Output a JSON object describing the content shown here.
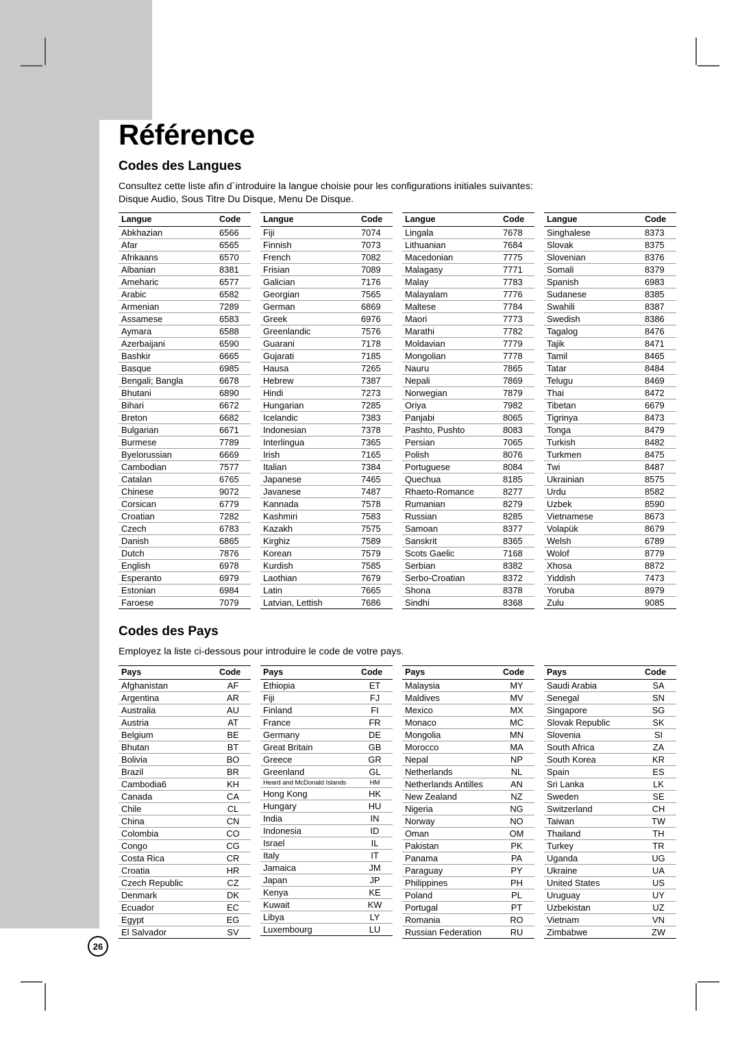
{
  "page": {
    "number": "26",
    "title": "Référence"
  },
  "languages_section": {
    "heading": "Codes des Langues",
    "intro": "Consultez cette liste afin d´introduire la langue choisie pour les configurations initiales suivantes: Disque Audio, Sous Titre Du Disque, Menu De Disque.",
    "intro_line1": "Consultez cette liste afin d´introduire la langue choisie pour les configurations initiales suivantes:",
    "intro_line2": "Disque Audio, Sous Titre Du Disque, Menu De Disque.",
    "headers": [
      "Langue",
      "Code"
    ],
    "columns": [
      [
        [
          "Abkhazian",
          "6566"
        ],
        [
          "Afar",
          "6565"
        ],
        [
          "Afrikaans",
          "6570"
        ],
        [
          "Albanian",
          "8381"
        ],
        [
          "Ameharic",
          "6577"
        ],
        [
          "Arabic",
          "6582"
        ],
        [
          "Armenian",
          "7289"
        ],
        [
          "Assamese",
          "6583"
        ],
        [
          "Aymara",
          "6588"
        ],
        [
          "Azerbaijani",
          "6590"
        ],
        [
          "Bashkir",
          "6665"
        ],
        [
          "Basque",
          "6985"
        ],
        [
          "Bengali; Bangla",
          "6678"
        ],
        [
          "Bhutani",
          "6890"
        ],
        [
          "Bihari",
          "6672"
        ],
        [
          "Breton",
          "6682"
        ],
        [
          "Bulgarian",
          "6671"
        ],
        [
          "Burmese",
          "7789"
        ],
        [
          "Byelorussian",
          "6669"
        ],
        [
          "Cambodian",
          "7577"
        ],
        [
          "Catalan",
          "6765"
        ],
        [
          "Chinese",
          "9072"
        ],
        [
          "Corsican",
          "6779"
        ],
        [
          "Croatian",
          "7282"
        ],
        [
          "Czech",
          "6783"
        ],
        [
          "Danish",
          "6865"
        ],
        [
          "Dutch",
          "7876"
        ],
        [
          "English",
          "6978"
        ],
        [
          "Esperanto",
          "6979"
        ],
        [
          "Estonian",
          "6984"
        ],
        [
          "Faroese",
          "7079"
        ]
      ],
      [
        [
          "Fiji",
          "7074"
        ],
        [
          "Finnish",
          "7073"
        ],
        [
          "French",
          "7082"
        ],
        [
          "Frisian",
          "7089"
        ],
        [
          "Galician",
          "7176"
        ],
        [
          "Georgian",
          "7565"
        ],
        [
          "German",
          "6869"
        ],
        [
          "Greek",
          "6976"
        ],
        [
          "Greenlandic",
          "7576"
        ],
        [
          "Guarani",
          "7178"
        ],
        [
          "Gujarati",
          "7185"
        ],
        [
          "Hausa",
          "7265"
        ],
        [
          "Hebrew",
          "7387"
        ],
        [
          "Hindi",
          "7273"
        ],
        [
          "Hungarian",
          "7285"
        ],
        [
          "Icelandic",
          "7383"
        ],
        [
          "Indonesian",
          "7378"
        ],
        [
          "Interlingua",
          "7365"
        ],
        [
          "Irish",
          "7165"
        ],
        [
          "Italian",
          "7384"
        ],
        [
          "Japanese",
          "7465"
        ],
        [
          "Javanese",
          "7487"
        ],
        [
          "Kannada",
          "7578"
        ],
        [
          "Kashmiri",
          "7583"
        ],
        [
          "Kazakh",
          "7575"
        ],
        [
          "Kirghiz",
          "7589"
        ],
        [
          "Korean",
          "7579"
        ],
        [
          "Kurdish",
          "7585"
        ],
        [
          "Laothian",
          "7679"
        ],
        [
          "Latin",
          "7665"
        ],
        [
          "Latvian, Lettish",
          "7686"
        ]
      ],
      [
        [
          "Lingala",
          "7678"
        ],
        [
          "Lithuanian",
          "7684"
        ],
        [
          "Macedonian",
          "7775"
        ],
        [
          "Malagasy",
          "7771"
        ],
        [
          "Malay",
          "7783"
        ],
        [
          "Malayalam",
          "7776"
        ],
        [
          "Maltese",
          "7784"
        ],
        [
          "Maori",
          "7773"
        ],
        [
          "Marathi",
          "7782"
        ],
        [
          "Moldavian",
          "7779"
        ],
        [
          "Mongolian",
          "7778"
        ],
        [
          "Nauru",
          "7865"
        ],
        [
          "Nepali",
          "7869"
        ],
        [
          "Norwegian",
          "7879"
        ],
        [
          "Oriya",
          "7982"
        ],
        [
          "Panjabi",
          "8065"
        ],
        [
          "Pashto, Pushto",
          "8083"
        ],
        [
          "Persian",
          "7065"
        ],
        [
          "Polish",
          "8076"
        ],
        [
          "Portuguese",
          "8084"
        ],
        [
          "Quechua",
          "8185"
        ],
        [
          "Rhaeto-Romance",
          "8277"
        ],
        [
          "Rumanian",
          "8279"
        ],
        [
          "Russian",
          "8285"
        ],
        [
          "Samoan",
          "8377"
        ],
        [
          "Sanskrit",
          "8365"
        ],
        [
          "Scots Gaelic",
          "7168"
        ],
        [
          "Serbian",
          "8382"
        ],
        [
          "Serbo-Croatian",
          "8372"
        ],
        [
          "Shona",
          "8378"
        ],
        [
          "Sindhi",
          "8368"
        ]
      ],
      [
        [
          "Singhalese",
          "8373"
        ],
        [
          "Slovak",
          "8375"
        ],
        [
          "Slovenian",
          "8376"
        ],
        [
          "Somali",
          "8379"
        ],
        [
          "Spanish",
          "6983"
        ],
        [
          "Sudanese",
          "8385"
        ],
        [
          "Swahili",
          "8387"
        ],
        [
          "Swedish",
          "8386"
        ],
        [
          "Tagalog",
          "8476"
        ],
        [
          "Tajik",
          "8471"
        ],
        [
          "Tamil",
          "8465"
        ],
        [
          "Tatar",
          "8484"
        ],
        [
          "Telugu",
          "8469"
        ],
        [
          "Thai",
          "8472"
        ],
        [
          "Tibetan",
          "6679"
        ],
        [
          "Tigrinya",
          "8473"
        ],
        [
          "Tonga",
          "8479"
        ],
        [
          "Turkish",
          "8482"
        ],
        [
          "Turkmen",
          "8475"
        ],
        [
          "Twi",
          "8487"
        ],
        [
          "Ukrainian",
          "8575"
        ],
        [
          "Urdu",
          "8582"
        ],
        [
          "Uzbek",
          "8590"
        ],
        [
          "Vietnamese",
          "8673"
        ],
        [
          "Volapük",
          "8679"
        ],
        [
          "Welsh",
          "6789"
        ],
        [
          "Wolof",
          "8779"
        ],
        [
          "Xhosa",
          "8872"
        ],
        [
          "Yiddish",
          "7473"
        ],
        [
          "Yoruba",
          "8979"
        ],
        [
          "Zulu",
          "9085"
        ]
      ]
    ]
  },
  "countries_section": {
    "heading": "Codes des Pays",
    "intro": "Employez la liste ci-dessous pour introduire le code de votre pays.",
    "headers": [
      "Pays",
      "Code"
    ],
    "columns": [
      [
        [
          "Afghanistan",
          "AF"
        ],
        [
          "Argentina",
          "AR"
        ],
        [
          "Australia",
          "AU"
        ],
        [
          "Austria",
          "AT"
        ],
        [
          "Belgium",
          "BE"
        ],
        [
          "Bhutan",
          "BT"
        ],
        [
          "Bolivia",
          "BO"
        ],
        [
          "Brazil",
          "BR"
        ],
        [
          "Cambodia6",
          "KH"
        ],
        [
          "Canada",
          "CA"
        ],
        [
          "Chile",
          "CL"
        ],
        [
          "China",
          "CN"
        ],
        [
          "Colombia",
          "CO"
        ],
        [
          "Congo",
          "CG"
        ],
        [
          "Costa Rica",
          "CR"
        ],
        [
          "Croatia",
          "HR"
        ],
        [
          "Czech Republic",
          "CZ"
        ],
        [
          "Denmark",
          "DK"
        ],
        [
          "Ecuador",
          "EC"
        ],
        [
          "Egypt",
          "EG"
        ],
        [
          "El Salvador",
          "SV"
        ]
      ],
      [
        [
          "Ethiopia",
          "ET"
        ],
        [
          "Fiji",
          "FJ"
        ],
        [
          "Finland",
          "FI"
        ],
        [
          "France",
          "FR"
        ],
        [
          "Germany",
          "DE"
        ],
        [
          "Great Britain",
          "GB"
        ],
        [
          "Greece",
          "GR"
        ],
        [
          "Greenland",
          "GL"
        ],
        [
          "Heard and McDonald Islands",
          "HM"
        ],
        [
          "Hong Kong",
          "HK"
        ],
        [
          "Hungary",
          "HU"
        ],
        [
          "India",
          "IN"
        ],
        [
          "Indonesia",
          "ID"
        ],
        [
          "Israel",
          "IL"
        ],
        [
          "Italy",
          "IT"
        ],
        [
          "Jamaica",
          "JM"
        ],
        [
          "Japan",
          "JP"
        ],
        [
          "Kenya",
          "KE"
        ],
        [
          "Kuwait",
          "KW"
        ],
        [
          "Libya",
          "LY"
        ],
        [
          "Luxembourg",
          "LU"
        ]
      ],
      [
        [
          "Malaysia",
          "MY"
        ],
        [
          "Maldives",
          "MV"
        ],
        [
          "Mexico",
          "MX"
        ],
        [
          "Monaco",
          "MC"
        ],
        [
          "Mongolia",
          "MN"
        ],
        [
          "Morocco",
          "MA"
        ],
        [
          "Nepal",
          "NP"
        ],
        [
          "Netherlands",
          "NL"
        ],
        [
          "Netherlands Antilles",
          "AN"
        ],
        [
          "New Zealand",
          "NZ"
        ],
        [
          "Nigeria",
          "NG"
        ],
        [
          "Norway",
          "NO"
        ],
        [
          "Oman",
          "OM"
        ],
        [
          "Pakistan",
          "PK"
        ],
        [
          "Panama",
          "PA"
        ],
        [
          "Paraguay",
          "PY"
        ],
        [
          "Philippines",
          "PH"
        ],
        [
          "Poland",
          "PL"
        ],
        [
          "Portugal",
          "PT"
        ],
        [
          "Romania",
          "RO"
        ],
        [
          "Russian Federation",
          "RU"
        ]
      ],
      [
        [
          "Saudi Arabia",
          "SA"
        ],
        [
          "Senegal",
          "SN"
        ],
        [
          "Singapore",
          "SG"
        ],
        [
          "Slovak Republic",
          "SK"
        ],
        [
          "Slovenia",
          "SI"
        ],
        [
          "South Africa",
          "ZA"
        ],
        [
          "South Korea",
          "KR"
        ],
        [
          "Spain",
          "ES"
        ],
        [
          "Sri Lanka",
          "LK"
        ],
        [
          "Sweden",
          "SE"
        ],
        [
          "Switzerland",
          "CH"
        ],
        [
          "Taiwan",
          "TW"
        ],
        [
          "Thailand",
          "TH"
        ],
        [
          "Turkey",
          "TR"
        ],
        [
          "Uganda",
          "UG"
        ],
        [
          "Ukraine",
          "UA"
        ],
        [
          "United States",
          "US"
        ],
        [
          "Uruguay",
          "UY"
        ],
        [
          "Uzbekistan",
          "UZ"
        ],
        [
          "Vietnam",
          "VN"
        ],
        [
          "Zimbabwe",
          "ZW"
        ]
      ]
    ]
  }
}
